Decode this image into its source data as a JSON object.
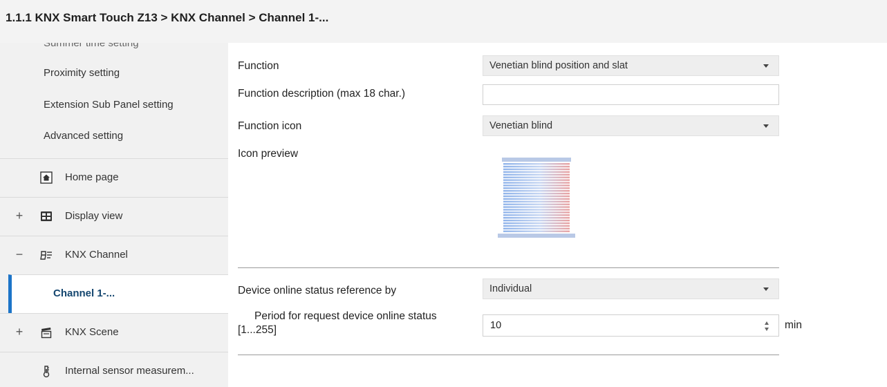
{
  "header": {
    "breadcrumb": "1.1.1 KNX Smart Touch Z13 > KNX Channel  > Channel 1-..."
  },
  "sidebar": {
    "sub_items": [
      {
        "label": "Summer time setting"
      },
      {
        "label": "Proximity setting"
      },
      {
        "label": "Extension Sub Panel setting"
      },
      {
        "label": "Advanced setting"
      }
    ],
    "nav": [
      {
        "expander": "",
        "icon": "home-icon",
        "label": "Home page"
      },
      {
        "expander": "+",
        "icon": "display-view-icon",
        "label": "Display view"
      },
      {
        "expander": "−",
        "icon": "knx-channel-icon",
        "label": "KNX Channel"
      },
      {
        "expander": "",
        "icon": "",
        "label": "Channel 1-...",
        "active": true
      },
      {
        "expander": "+",
        "icon": "scene-clapper-icon",
        "label": "KNX Scene"
      },
      {
        "expander": "",
        "icon": "thermometer-icon",
        "label": "Internal sensor measurem..."
      }
    ]
  },
  "form": {
    "function": {
      "label": "Function",
      "value": "Venetian blind position and slat"
    },
    "description": {
      "label": "Function description (max 18 char.)",
      "value": ""
    },
    "icon": {
      "label": "Function icon",
      "value": "Venetian blind"
    },
    "icon_preview": {
      "label": "Icon preview",
      "icon": "venetian-blind-icon"
    },
    "online_status": {
      "label": "Device online status reference by",
      "value": "Individual"
    },
    "period": {
      "label_line1": "Period for request device online status",
      "label_line2": "[1...255]",
      "value": "10",
      "unit": "min"
    }
  },
  "colors": {
    "accent": "#1c74c8",
    "sidebar_bg": "#f1f1f1",
    "header_bg": "#f3f3f3"
  }
}
